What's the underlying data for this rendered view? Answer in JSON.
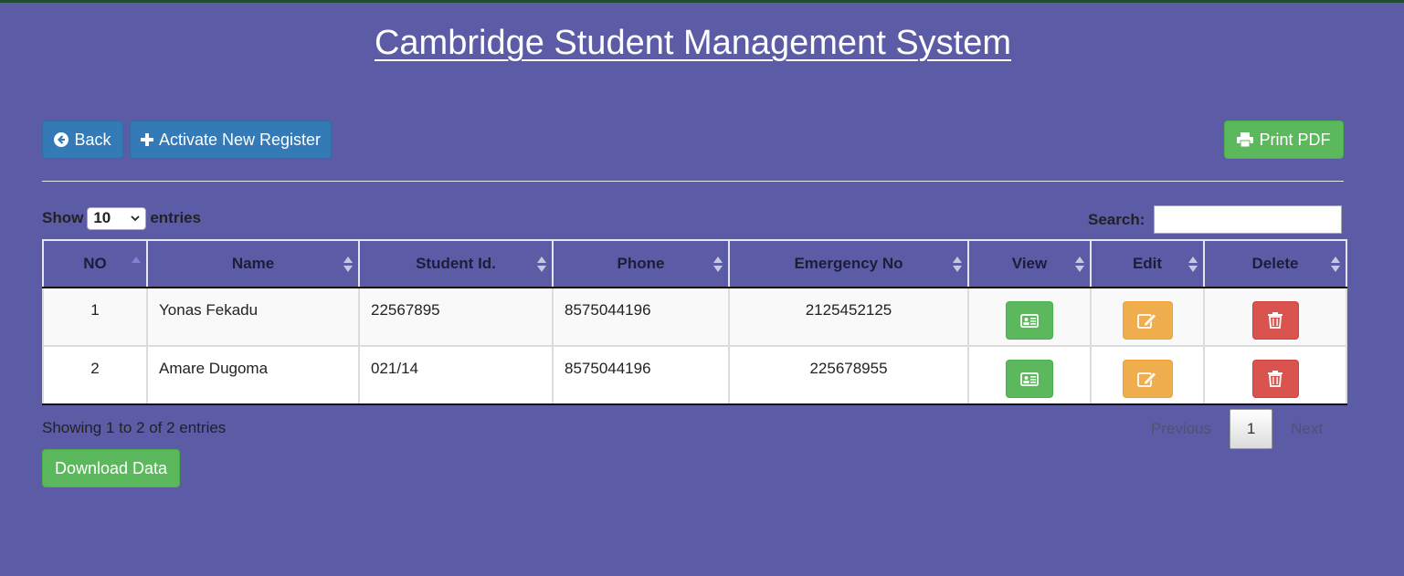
{
  "page": {
    "title": "Cambridge Student Management System"
  },
  "toolbar": {
    "back_label": "Back",
    "activate_label": "Activate New Register",
    "print_label": "Print PDF"
  },
  "controls": {
    "show_label": "Show",
    "entries_value": "10",
    "entries_label": "entries",
    "search_label": "Search:",
    "search_value": ""
  },
  "table": {
    "headers": [
      "NO",
      "Name",
      "Student Id.",
      "Phone",
      "Emergency No",
      "View",
      "Edit",
      "Delete"
    ],
    "sorted_column": "NO",
    "rows": [
      {
        "no": "1",
        "name": "Yonas Fekadu",
        "student_id": "22567895",
        "phone": "8575044196",
        "emergency": "2125452125"
      },
      {
        "no": "2",
        "name": "Amare Dugoma",
        "student_id": "021/14",
        "phone": "8575044196",
        "emergency": "225678955"
      }
    ]
  },
  "footer": {
    "info": "Showing 1 to 2 of 2 entries",
    "previous": "Previous",
    "page": "1",
    "next": "Next",
    "download_label": "Download Data"
  },
  "colors": {
    "background": "#5b5ba6",
    "primary": "#337ab7",
    "success": "#5cb85c",
    "warning": "#f0ad4e",
    "danger": "#d9534f"
  },
  "icons": {
    "back": "circle-arrow-left-icon",
    "activate": "plus-icon",
    "print": "printer-icon",
    "view": "id-card-icon",
    "edit": "edit-icon",
    "delete": "trash-icon"
  }
}
